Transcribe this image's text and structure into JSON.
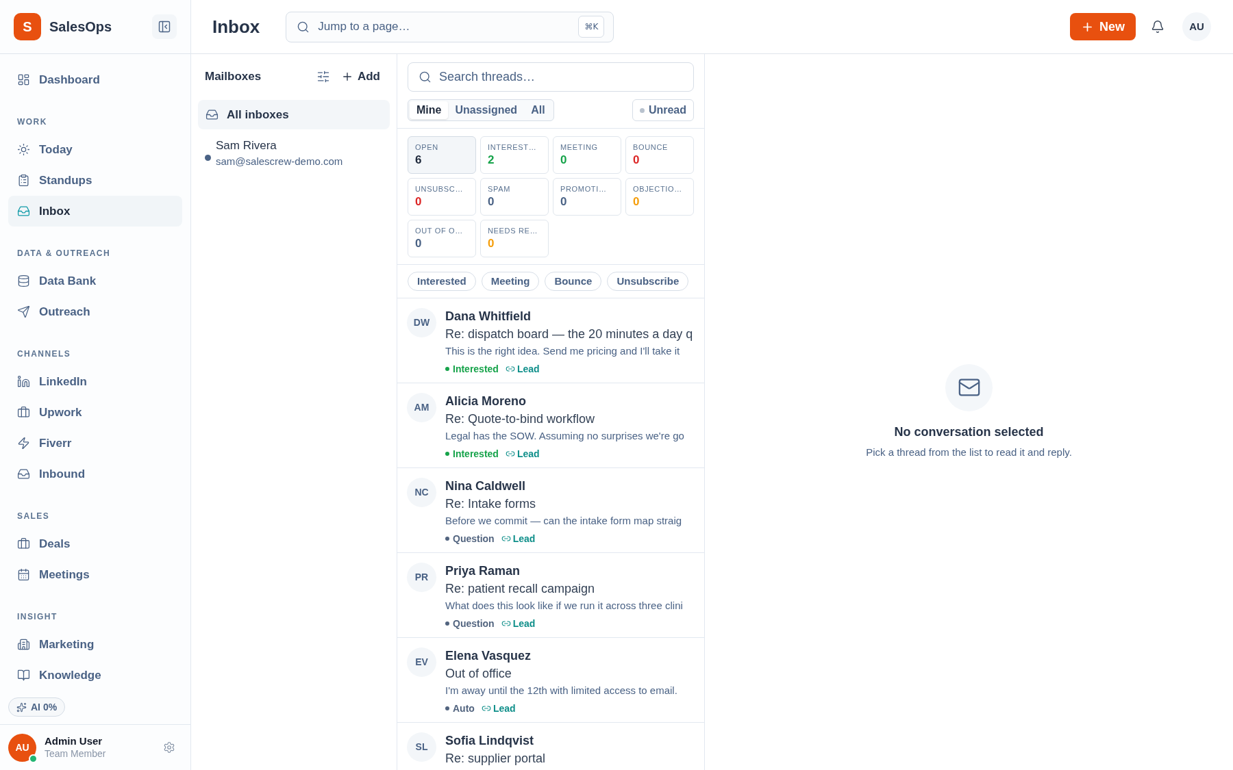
{
  "sidebar": {
    "brand": {
      "initial": "S",
      "name": "SalesOps"
    },
    "sections": [
      {
        "items": [
          {
            "label": "Dashboard",
            "selected": false
          }
        ]
      },
      {
        "title": "WORK",
        "items": [
          {
            "label": "Today",
            "selected": false
          },
          {
            "label": "Standups",
            "selected": false
          },
          {
            "label": "Inbox",
            "selected": true
          }
        ]
      },
      {
        "title": "DATA & OUTREACH",
        "items": [
          {
            "label": "Data Bank",
            "selected": false
          },
          {
            "label": "Outreach",
            "selected": false
          }
        ]
      },
      {
        "title": "CHANNELS",
        "items": [
          {
            "label": "LinkedIn",
            "selected": false
          },
          {
            "label": "Upwork",
            "selected": false
          },
          {
            "label": "Fiverr",
            "selected": false
          },
          {
            "label": "Inbound",
            "selected": false
          }
        ]
      },
      {
        "title": "SALES",
        "items": [
          {
            "label": "Deals",
            "selected": false
          },
          {
            "label": "Meetings",
            "selected": false
          }
        ]
      },
      {
        "title": "INSIGHT",
        "items": [
          {
            "label": "Marketing",
            "selected": false
          },
          {
            "label": "Knowledge",
            "selected": false
          }
        ]
      }
    ],
    "ai_badge": "AI 0%",
    "user": {
      "initials": "AU",
      "name": "Admin User",
      "role": "Team Member",
      "online": true
    }
  },
  "header": {
    "title": "Inbox",
    "search": {
      "placeholder": "Jump to a page…",
      "shortcut": "⌘K"
    },
    "new_button": "New",
    "avatar": "AU"
  },
  "mailboxes": {
    "title": "Mailboxes",
    "add_button": "Add",
    "items": [
      {
        "kind": "all",
        "label": "All inboxes",
        "selected": true
      },
      {
        "kind": "account",
        "name": "Sam Rivera",
        "email": "sam@salescrew-demo.com",
        "color": "#4a6285",
        "selected": false
      }
    ]
  },
  "thread_list": {
    "search": {
      "placeholder": "Search threads…"
    },
    "scopes": [
      {
        "label": "Mine",
        "selected": true
      },
      {
        "label": "Unassigned",
        "selected": false
      },
      {
        "label": "All",
        "selected": false
      }
    ],
    "unread_filter": {
      "label": "Unread",
      "on": false
    },
    "stats": [
      {
        "label": "OPEN",
        "value": "6",
        "color": "#1e293b",
        "selected": true
      },
      {
        "label": "INTEREST…",
        "value": "2",
        "color": "#16a34a",
        "selected": false
      },
      {
        "label": "MEETING",
        "value": "0",
        "color": "#16a34a",
        "selected": false
      },
      {
        "label": "BOUNCE",
        "value": "0",
        "color": "#dc2626",
        "selected": false
      },
      {
        "label": "UNSUBSC…",
        "value": "0",
        "color": "#dc2626",
        "selected": false
      },
      {
        "label": "SPAM",
        "value": "0",
        "color": "#4a6285",
        "selected": false
      },
      {
        "label": "PROMOTI…",
        "value": "0",
        "color": "#4a6285",
        "selected": false
      },
      {
        "label": "OBJECTIO…",
        "value": "0",
        "color": "#f59e0b",
        "selected": false
      },
      {
        "label": "OUT OF O…",
        "value": "0",
        "color": "#4a6285",
        "selected": false
      },
      {
        "label": "NEEDS RE…",
        "value": "0",
        "color": "#f59e0b",
        "selected": false
      }
    ],
    "chips": [
      {
        "label": "Interested"
      },
      {
        "label": "Meeting"
      },
      {
        "label": "Bounce"
      },
      {
        "label": "Unsubscribe"
      }
    ],
    "threads": [
      {
        "initials": "DW",
        "name": "Dana Whitfield",
        "subject": "Re: dispatch board — the 20 minutes a day q",
        "snippet": "This is the right idea. Send me pricing and I'll take it",
        "status": {
          "label": "Interested",
          "color": "#16a34a"
        },
        "link": "Lead"
      },
      {
        "initials": "AM",
        "name": "Alicia Moreno",
        "subject": "Re: Quote-to-bind workflow",
        "snippet": "Legal has the SOW. Assuming no surprises we're go",
        "status": {
          "label": "Interested",
          "color": "#16a34a"
        },
        "link": "Lead"
      },
      {
        "initials": "NC",
        "name": "Nina Caldwell",
        "subject": "Re: Intake forms",
        "snippet": "Before we commit — can the intake form map straig",
        "status": {
          "label": "Question",
          "color": "#52647f"
        },
        "link": "Lead"
      },
      {
        "initials": "PR",
        "name": "Priya Raman",
        "subject": "Re: patient recall campaign",
        "snippet": "What does this look like if we run it across three clini",
        "status": {
          "label": "Question",
          "color": "#52647f"
        },
        "link": "Lead"
      },
      {
        "initials": "EV",
        "name": "Elena Vasquez",
        "subject": "Out of office",
        "snippet": "I'm away until the 12th with limited access to email.",
        "status": {
          "label": "Auto",
          "color": "#52647f"
        },
        "link": "Lead"
      },
      {
        "initials": "SL",
        "name": "Sofia Lindqvist",
        "subject": "Re: supplier portal"
      }
    ]
  },
  "detail": {
    "title": "No conversation selected",
    "hint": "Pick a thread from the list to read it and reply."
  }
}
